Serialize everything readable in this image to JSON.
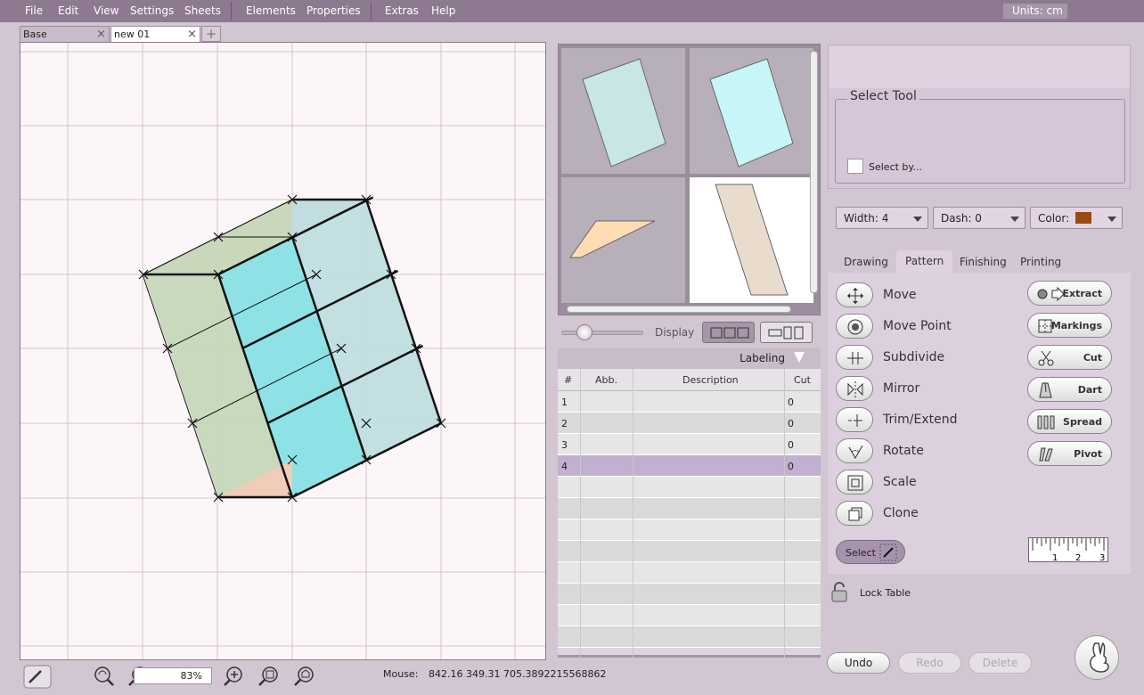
{
  "menu": [
    "File",
    "Edit",
    "View",
    "Settings",
    "Sheets",
    "Elements",
    "Properties",
    "Extras",
    "Help"
  ],
  "units": "Units:   cm",
  "tabs": [
    {
      "label": "Base"
    },
    {
      "label": "new 01"
    }
  ],
  "bottom": {
    "zoom": "83%",
    "mouse_label": "Mouse:",
    "mouse_value": "842.16 349.31  705.3892215568862"
  },
  "display_label": "Display",
  "labeling": "Labeling",
  "table": {
    "headers": [
      "#",
      "Abb.",
      "Description",
      "Cut"
    ],
    "rows": [
      {
        "num": "1",
        "abb": "",
        "desc": "",
        "cut": "0"
      },
      {
        "num": "2",
        "abb": "",
        "desc": "",
        "cut": "0"
      },
      {
        "num": "3",
        "abb": "",
        "desc": "",
        "cut": "0"
      },
      {
        "num": "4",
        "abb": "",
        "desc": "",
        "cut": "0"
      }
    ]
  },
  "select_tool": {
    "title": "Select Tool",
    "select_by": "Select by..."
  },
  "style": {
    "width": "Width: 4",
    "dash": "Dash: 0",
    "color_label": "Color:",
    "color": "#984a10"
  },
  "tool_tabs": [
    "Drawing",
    "Pattern",
    "Finishing",
    "Printing"
  ],
  "tools_left": [
    "Move",
    "Move Point",
    "Subdivide",
    "Mirror",
    "Trim/Extend",
    "Rotate",
    "Scale",
    "Clone"
  ],
  "tools_right": [
    "Extract",
    "Markings",
    "Cut",
    "Dart",
    "Spread",
    "Pivot"
  ],
  "select_pill": "Select",
  "lock_table": "Lock Table",
  "actions": {
    "undo": "Undo",
    "redo": "Redo",
    "delete": "Delete"
  },
  "ruler_ticks": [
    "1",
    "2",
    "3"
  ]
}
